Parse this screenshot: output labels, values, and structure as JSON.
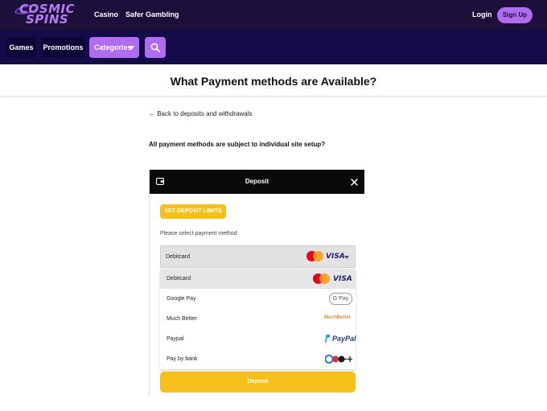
{
  "header": {
    "logo": {
      "line1": "COSMIC",
      "line2": "SPINS"
    },
    "links": [
      "Casino",
      "Safer Gambling"
    ],
    "login": "Login",
    "signup": "Sign Up"
  },
  "nav": {
    "games": "Games",
    "promotions": "Promotions",
    "categories": "Categories"
  },
  "page": {
    "title": "What Payment methods are Available?",
    "back_link": "← Back to deposits and withdrawals",
    "note": "All payment methods are subject to individual site setup?"
  },
  "modal": {
    "title": "Deposit",
    "limits_button": "SET DEPOSIT LIMITS",
    "select_label": "Please select payment method",
    "selected": "Debitcard",
    "options": [
      {
        "label": "Debitcard",
        "logo": "mastercard-visa-logo"
      },
      {
        "label": "Google Pay",
        "logo": "google-pay-logo"
      },
      {
        "label": "Much Better",
        "logo": "muchbetter-logo"
      },
      {
        "label": "Paypal",
        "logo": "paypal-logo"
      },
      {
        "label": "Pay by bank",
        "logo": "bank-logos"
      }
    ],
    "deposit_button": "Deposit",
    "logo_text": {
      "visa": "VISA",
      "gpay": "G Pay",
      "muchbetter": "MuchBetter",
      "paypal": "PayPal"
    }
  },
  "colors": {
    "header_bg": "#1c0f3a",
    "nav_bg": "#140b4a",
    "accent_purple": "#b06cf0",
    "accent_yellow": "#f4c019"
  }
}
